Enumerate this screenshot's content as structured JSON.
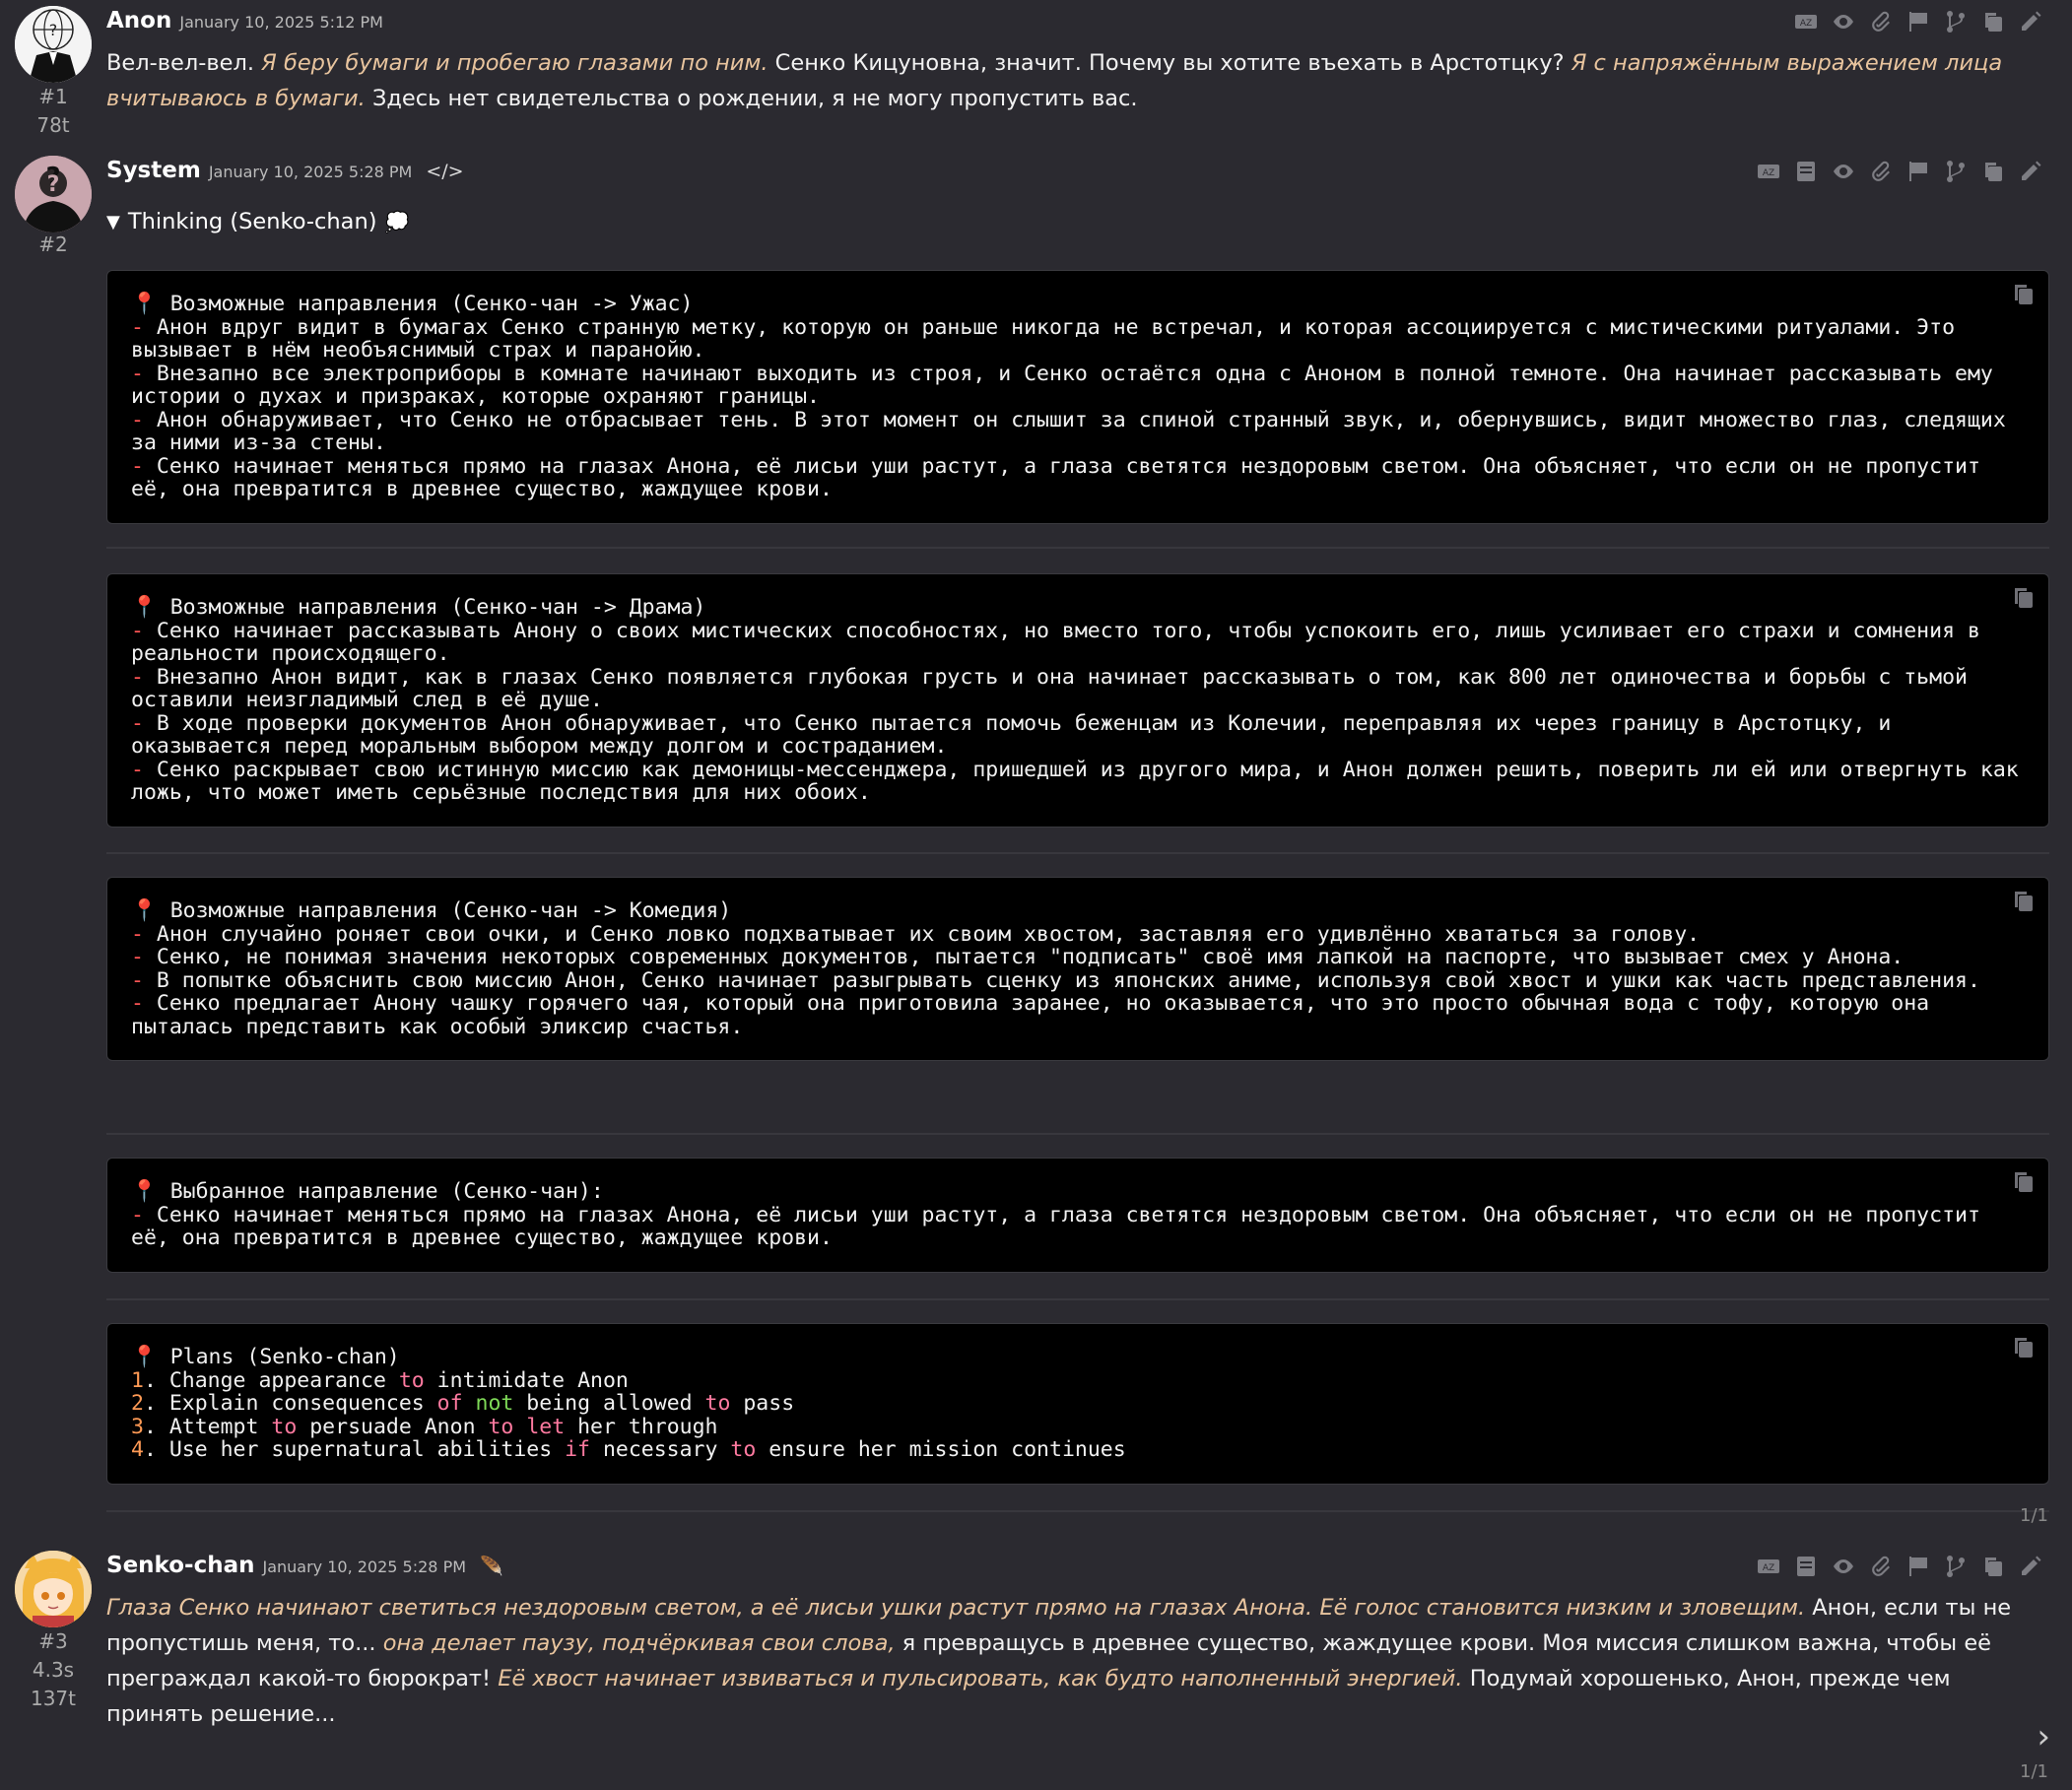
{
  "messages": [
    {
      "name": "Anon",
      "time": "January 10, 2025 5:12 PM",
      "index": "#1",
      "tokens": "78t",
      "segments": [
        {
          "t": "Вел-вел-вел. ",
          "q": false
        },
        {
          "t": "Я беру бумаги и пробегаю глазами по ним.",
          "q": true
        },
        {
          "t": " Сенко Кицуновна, значит. Почему вы хотите въехать в Арстотцку? ",
          "q": false
        },
        {
          "t": "Я с напряжённым выражением лица вчитываюсь в бумаги.",
          "q": true
        },
        {
          "t": " Здесь нет свидетельства о рождении, я не могу пропустить вас.",
          "q": false
        }
      ]
    },
    {
      "name": "System",
      "time": "January 10, 2025 5:28 PM",
      "index": "#2",
      "thinking_label": "Thinking (Senko-chan)",
      "blocks": [
        {
          "title": "📍 Возможные направления (Сенко-чан -> Ужас)",
          "items": [
            "Анон вдруг видит в бумагах Сенко странную метку, которую он раньше никогда не встречал, и которая ассоциируется с мистическими ритуалами. Это вызывает в нём необъяснимый страх и паранойю.",
            "Внезапно все электроприборы в комнате начинают выходить из строя, и Сенко остаётся одна с Аноном в полной темноте. Она начинает рассказывать ему истории о духах и призраках, которые охраняют границы.",
            "Анон обнаруживает, что Сенко не отбрасывает тень. В этот момент он слышит за спиной странный звук, и, обернувшись, видит множество глаз, следящих за ними из-за стены.",
            "Сенко начинает меняться прямо на глазах Анона, её лисьи уши растут, а глаза светятся нездоровым светом. Она объясняет, что если он не пропустит её, она превратится в древнее существо, жаждущее крови."
          ]
        },
        {
          "title": "📍 Возможные направления (Сенко-чан -> Драма)",
          "items": [
            "Сенко начинает рассказывать Анону о своих мистических способностях, но вместо того, чтобы успокоить его, лишь усиливает его страхи и сомнения в реальности происходящего.",
            "Внезапно Анон видит, как в глазах Сенко появляется глубокая грусть и она начинает рассказывать о том, как 800 лет одиночества и борьбы с тьмой оставили неизгладимый след в её душе.",
            "В ходе проверки документов Анон обнаруживает, что Сенко пытается помочь беженцам из Колечии, переправляя их через границу в Арстотцку, и оказывается перед моральным выбором между долгом и состраданием.",
            "Сенко раскрывает свою истинную миссию как демоницы-мессенджера, пришедшей из другого мира, и Анон должен решить, поверить ли ей или отвергнуть как ложь, что может иметь серьёзные последствия для них обоих."
          ]
        },
        {
          "title": "📍 Возможные направления (Сенко-чан -> Комедия)",
          "items": [
            "Анон случайно роняет свои очки, и Сенко ловко подхватывает их своим хвостом, заставляя его удивлённо хвататься за голову.",
            "Сенко, не понимая значения некоторых современных документов, пытается \"подписать\" своё имя лапкой на паспорте, что вызывает смех у Анона.",
            "В попытке объяснить свою миссию Анон, Сенко начинает разыгрывать сценку из японских аниме, используя свой хвост и ушки как часть представления.",
            "Сенко предлагает Анону чашку горячего чая, который она приготовила заранее, но оказывается, что это просто обычная вода с тофу, которую она пыталась представить как особый эликсир счастья."
          ]
        },
        {
          "title": "📍 Выбранное направление (Сенко-чан):",
          "items": [
            "Сенко начинает меняться прямо на глазах Анона, её лисьи уши растут, а глаза светятся нездоровым светом. Она объясняет, что если он не пропустит её, она превратится в древнее существо, жаждущее крови."
          ]
        }
      ],
      "plans": {
        "title": "📍 Plans (Senko-chan)",
        "lines": [
          [
            {
              "t": "1",
              "c": "num"
            },
            {
              "t": ". Change appearance "
            },
            {
              "t": "to",
              "c": "kw"
            },
            {
              "t": " intimidate Anon"
            }
          ],
          [
            {
              "t": "2",
              "c": "num"
            },
            {
              "t": ". Explain consequences "
            },
            {
              "t": "of",
              "c": "kw"
            },
            {
              "t": " "
            },
            {
              "t": "not",
              "c": "kw2"
            },
            {
              "t": " being allowed "
            },
            {
              "t": "to",
              "c": "kw"
            },
            {
              "t": " pass"
            }
          ],
          [
            {
              "t": "3",
              "c": "num"
            },
            {
              "t": ". Attempt "
            },
            {
              "t": "to",
              "c": "kw"
            },
            {
              "t": " persuade Anon "
            },
            {
              "t": "to",
              "c": "kw"
            },
            {
              "t": " "
            },
            {
              "t": "let",
              "c": "kw"
            },
            {
              "t": " her through"
            }
          ],
          [
            {
              "t": "4",
              "c": "num"
            },
            {
              "t": ". Use her supernatural abilities "
            },
            {
              "t": "if",
              "c": "kw"
            },
            {
              "t": " necessary "
            },
            {
              "t": "to",
              "c": "kw"
            },
            {
              "t": " ensure her mission continues"
            }
          ]
        ]
      },
      "swipe": "1/1"
    },
    {
      "name": "Senko-chan",
      "time": "January 10, 2025 5:28 PM",
      "index": "#3",
      "gen_time": "4.3s",
      "tokens": "137t",
      "segments": [
        {
          "t": "Глаза Сенко начинают светиться нездоровым светом, а её лисьи ушки растут прямо на глазах Анона. Её голос становится низким и зловещим.",
          "q": true
        },
        {
          "t": " Анон, если ты не пропустишь меня, то... ",
          "q": false
        },
        {
          "t": "она делает паузу, подчёркивая свои слова,",
          "q": true
        },
        {
          "t": " я превращусь в древнее существо, жаждущее крови. Моя миссия слишком важна, чтобы её преграждал какой-то бюрократ! ",
          "q": false
        },
        {
          "t": "Её хвост начинает извиваться и пульсировать, как будто наполненный энергией.",
          "q": true
        },
        {
          "t": " Подумай хорошенько, Анон, прежде чем принять решение...",
          "q": false
        }
      ],
      "swipe": "1/1"
    }
  ],
  "colors": {
    "background": "#2b2a30",
    "quote": "#e8c49e",
    "code_bg": "#000000",
    "dash": "#ff5555"
  }
}
